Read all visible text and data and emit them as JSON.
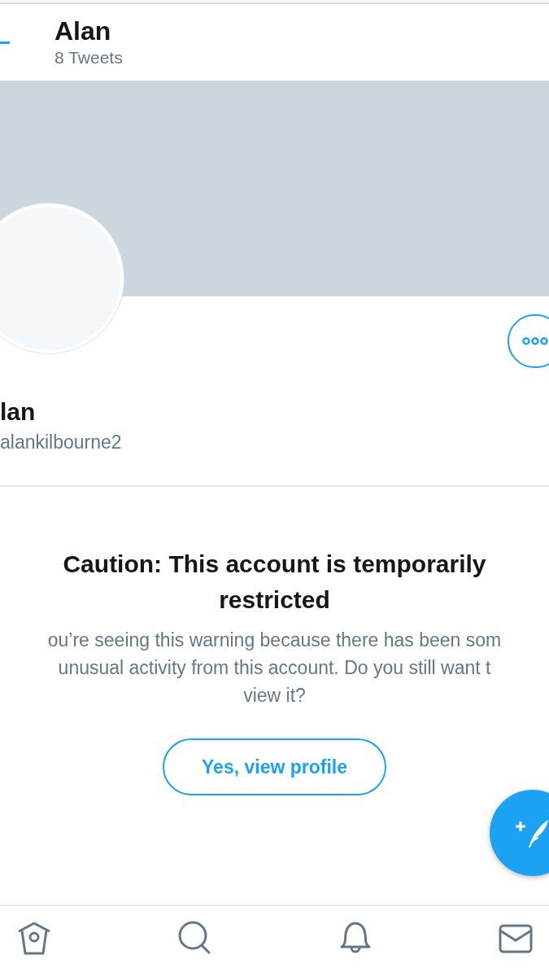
{
  "header": {
    "title": "Alan",
    "subtitle": "8 Tweets"
  },
  "profile": {
    "name": "lan",
    "handle": "alankilbourne2"
  },
  "warning": {
    "title": "Caution: This account is temporarily restricted",
    "body_lines": [
      "ou’re seeing this warning because there has been som",
      "unusual activity from this account. Do you still want t",
      "view it?"
    ],
    "button": "Yes, view profile"
  }
}
